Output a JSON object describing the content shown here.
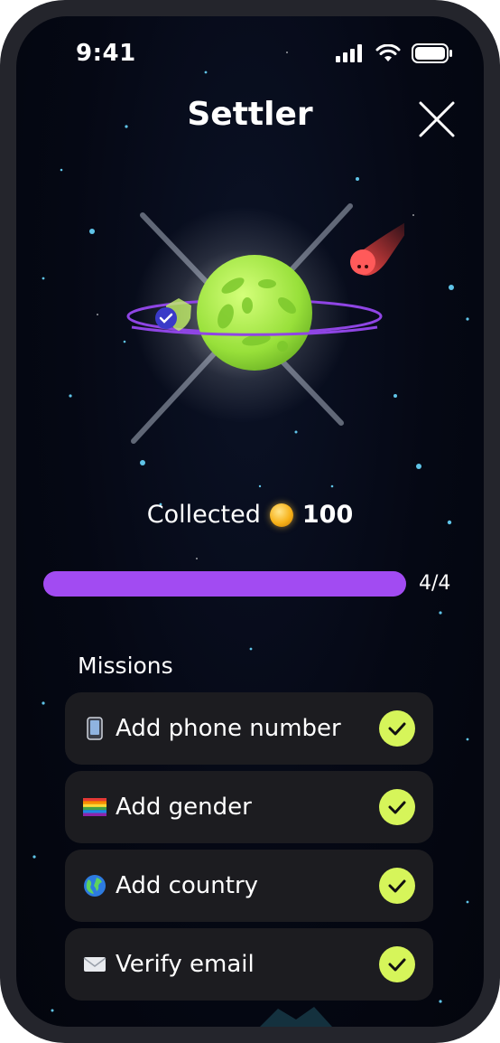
{
  "status": {
    "time": "9:41"
  },
  "header": {
    "title": "Settler"
  },
  "reward": {
    "label": "Collected",
    "amount": "100"
  },
  "progress": {
    "text": "4/4",
    "fraction": 1.0
  },
  "missions": {
    "title": "Missions",
    "items": [
      {
        "label": "Add phone number",
        "icon": "phone-emoji-icon",
        "done": true
      },
      {
        "label": "Add gender",
        "icon": "rainbow-flag-icon",
        "done": true
      },
      {
        "label": "Add country",
        "icon": "globe-icon",
        "done": true
      },
      {
        "label": "Verify email",
        "icon": "envelope-icon",
        "done": true
      }
    ]
  },
  "colors": {
    "accent": "#a24bf2",
    "check": "#d6f55a",
    "planet": "#9be23a",
    "card": "#1c1c20"
  }
}
